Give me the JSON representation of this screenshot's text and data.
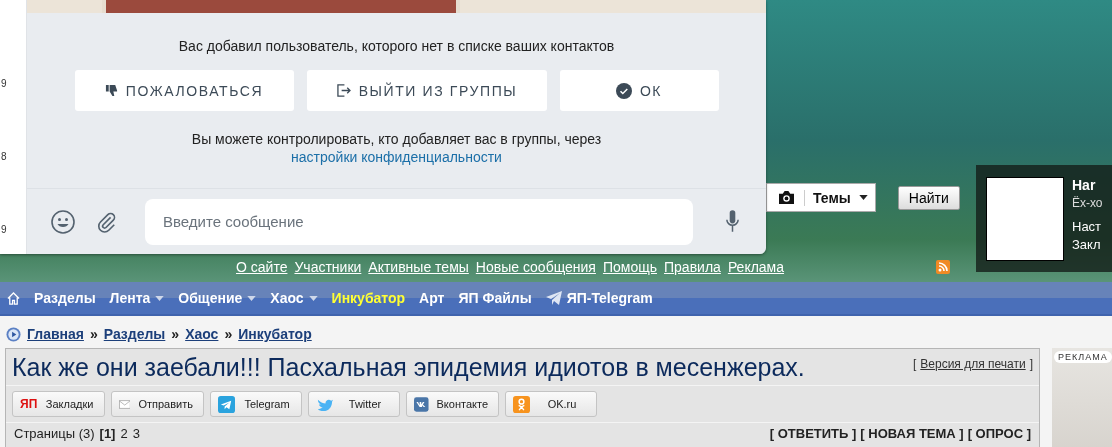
{
  "chat": {
    "side_digits": [
      "9",
      "8",
      "9"
    ],
    "notice": "Вас добавил пользователь, которого нет в списке ваших контактов",
    "actions": [
      {
        "kind": "report",
        "label": "ПОЖАЛОВАТЬСЯ"
      },
      {
        "kind": "leave",
        "label": "ВЫЙТИ ИЗ ГРУППЫ"
      },
      {
        "kind": "ok",
        "label": "ОК"
      }
    ],
    "privacy_text": "Вы можете контролировать, кто добавляет вас в группы, через",
    "privacy_link": "настройки конфиденциальности",
    "composer": {
      "placeholder": "Введите сообщение"
    }
  },
  "header": {
    "search_scope": "Темы",
    "search_button": "Найти",
    "links": [
      "О сайте",
      "Участники",
      "Активные темы",
      "Новые сообщения",
      "Помощь",
      "Правила",
      "Реклама"
    ],
    "user": {
      "name": "Har",
      "status": "Ёх-хо",
      "links": [
        "Наст",
        "Закл"
      ]
    }
  },
  "nav": [
    {
      "label": "Разделы",
      "dropdown": false,
      "highlighted": false,
      "kind": "plain"
    },
    {
      "label": "Лента",
      "dropdown": true,
      "highlighted": false,
      "kind": "plain"
    },
    {
      "label": "Общение",
      "dropdown": true,
      "highlighted": false,
      "kind": "plain"
    },
    {
      "label": "Хаос",
      "dropdown": true,
      "highlighted": false,
      "kind": "plain"
    },
    {
      "label": "Инкубатор",
      "dropdown": false,
      "highlighted": true,
      "kind": "plain"
    },
    {
      "label": "Арт",
      "dropdown": false,
      "highlighted": false,
      "kind": "plain"
    },
    {
      "label": "ЯП Файлы",
      "dropdown": false,
      "highlighted": false,
      "kind": "plain"
    },
    {
      "label": "ЯП-Telegram",
      "dropdown": false,
      "highlighted": false,
      "kind": "telegram"
    }
  ],
  "breadcrumb": {
    "separator": "»",
    "items": [
      "Главная",
      "Разделы",
      "Хаос",
      "Инкубатор"
    ]
  },
  "topic": {
    "title": "Как же они заебали!!! Пасхальная эпидемия идиотов в месенжерах.",
    "print_link": {
      "before": "[",
      "label": "Версия для печати",
      "after": "]"
    },
    "share": [
      {
        "kind": "bookmarks",
        "badge": "ЯП",
        "label": "Закладки"
      },
      {
        "kind": "mail",
        "label": "Отправить"
      },
      {
        "kind": "telegram",
        "label": "Telegram"
      },
      {
        "kind": "twitter",
        "label": "Twitter"
      },
      {
        "kind": "vk",
        "label": "Вконтакте"
      },
      {
        "kind": "ok",
        "label": "OK.ru"
      }
    ],
    "pages": {
      "label": "Страницы (3)",
      "items": [
        {
          "label": "[1]",
          "selected": true
        },
        {
          "label": "2",
          "selected": false
        },
        {
          "label": "3",
          "selected": false
        }
      ]
    },
    "actions": [
      "[ ОТВЕТИТЬ ]",
      "[ НОВАЯ ТЕМА ]",
      "[ ОПРОС ]"
    ]
  },
  "ad": {
    "label": "РЕКЛАМА"
  }
}
